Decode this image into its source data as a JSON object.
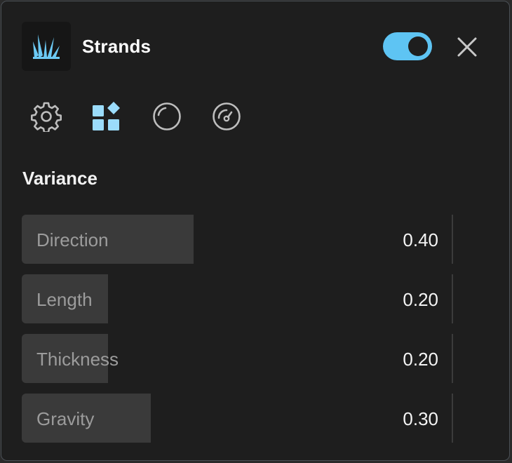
{
  "header": {
    "title": "Strands",
    "app_icon": "grass-icon",
    "toggle_on": true,
    "close_icon": "close-icon"
  },
  "tabs": [
    {
      "icon": "gear-icon",
      "active": false
    },
    {
      "icon": "shapes-icon",
      "active": true
    },
    {
      "icon": "circle-icon",
      "active": false
    },
    {
      "icon": "gauge-icon",
      "active": false
    }
  ],
  "section": {
    "title": "Variance"
  },
  "rows": [
    {
      "label": "Direction",
      "value": "0.40",
      "level": 0.4
    },
    {
      "label": "Length",
      "value": "0.20",
      "level": 0.2
    },
    {
      "label": "Thickness",
      "value": "0.20",
      "level": 0.2
    },
    {
      "label": "Gravity",
      "value": "0.30",
      "level": 0.3
    }
  ],
  "colors": {
    "accent": "#5ec4f3",
    "panel": "#1e1e1e",
    "fill": "#3a3a3a"
  }
}
